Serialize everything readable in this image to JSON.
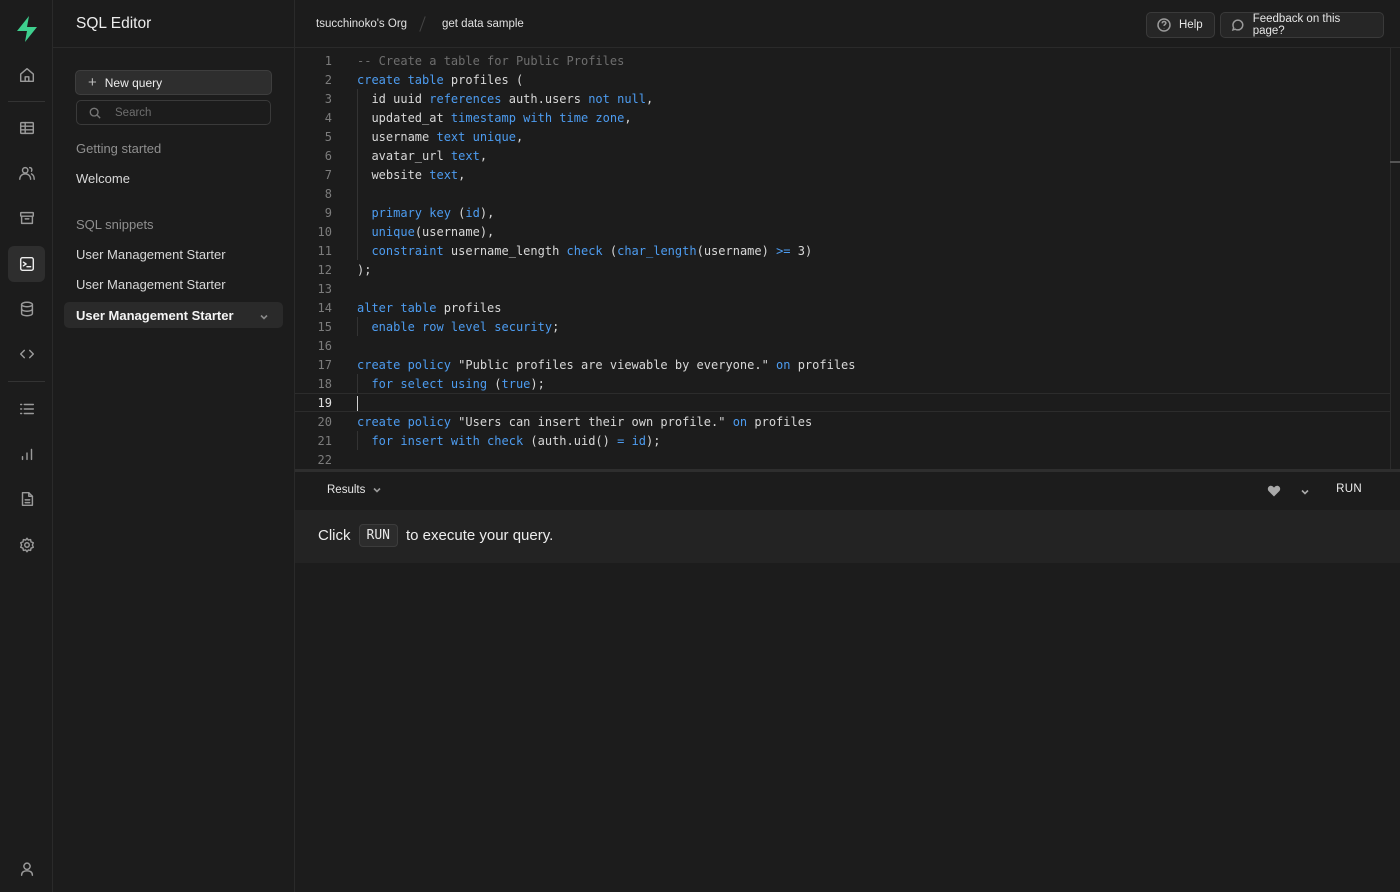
{
  "sidebar": {
    "title": "SQL Editor",
    "new_query": "New query",
    "search_placeholder": "Search",
    "getting_started_label": "Getting started",
    "welcome": "Welcome",
    "snippets_label": "SQL snippets",
    "snippets": [
      "User Management Starter",
      "User Management Starter",
      "User Management Starter"
    ]
  },
  "topbar": {
    "org": "tsucchinoko's Org",
    "project": "get data sample",
    "help": "Help",
    "feedback": "Feedback on this page?"
  },
  "editor": {
    "line_numbers": [
      "1",
      "2",
      "3",
      "4",
      "5",
      "6",
      "7",
      "8",
      "9",
      "10",
      "11",
      "12",
      "13",
      "14",
      "15",
      "16",
      "17",
      "18",
      "19",
      "20",
      "21",
      "22"
    ],
    "active_line": 19
  },
  "results": {
    "tab_label": "Results",
    "run_label": "RUN",
    "hint_before": "Click",
    "hint_key": "RUN",
    "hint_after": "to execute your query."
  },
  "colors": {
    "keyword": "#4d9cf0",
    "comment": "#6e6e6e",
    "brand": "#3ecf8e",
    "background": "#1c1c1c"
  }
}
